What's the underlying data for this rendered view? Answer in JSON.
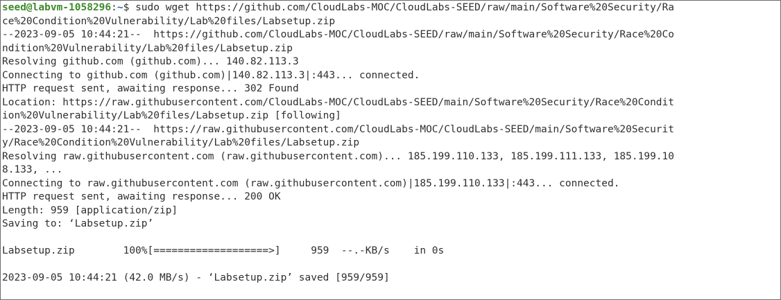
{
  "prompt": {
    "user_host": "seed@labvm-1058296",
    "separator": ":",
    "path": "~",
    "symbol": "$ ",
    "command": "sudo wget https://github.com/CloudLabs-MOC/CloudLabs-SEED/raw/main/Software%20Security/Ra"
  },
  "output": [
    "ce%20Condition%20Vulnerability/Lab%20files/Labsetup.zip",
    "--2023-09-05 10:44:21--  https://github.com/CloudLabs-MOC/CloudLabs-SEED/raw/main/Software%20Security/Race%20Co",
    "ndition%20Vulnerability/Lab%20files/Labsetup.zip",
    "Resolving github.com (github.com)... 140.82.113.3",
    "Connecting to github.com (github.com)|140.82.113.3|:443... connected.",
    "HTTP request sent, awaiting response... 302 Found",
    "Location: https://raw.githubusercontent.com/CloudLabs-MOC/CloudLabs-SEED/main/Software%20Security/Race%20Condit",
    "ion%20Vulnerability/Lab%20files/Labsetup.zip [following]",
    "--2023-09-05 10:44:21--  https://raw.githubusercontent.com/CloudLabs-MOC/CloudLabs-SEED/main/Software%20Securit",
    "y/Race%20Condition%20Vulnerability/Lab%20files/Labsetup.zip",
    "Resolving raw.githubusercontent.com (raw.githubusercontent.com)... 185.199.110.133, 185.199.111.133, 185.199.10",
    "8.133, ...",
    "Connecting to raw.githubusercontent.com (raw.githubusercontent.com)|185.199.110.133|:443... connected.",
    "HTTP request sent, awaiting response... 200 OK",
    "Length: 959 [application/zip]",
    "Saving to: ‘Labsetup.zip’",
    "",
    "Labsetup.zip        100%[===================>]     959  --.-KB/s    in 0s",
    "",
    "2023-09-05 10:44:21 (42.0 MB/s) - ‘Labsetup.zip’ saved [959/959]"
  ],
  "colors": {
    "prompt_user": "#3e8a2b",
    "prompt_path": "#2f5fa8",
    "text": "#2f2f2f",
    "background": "#ffffff"
  }
}
